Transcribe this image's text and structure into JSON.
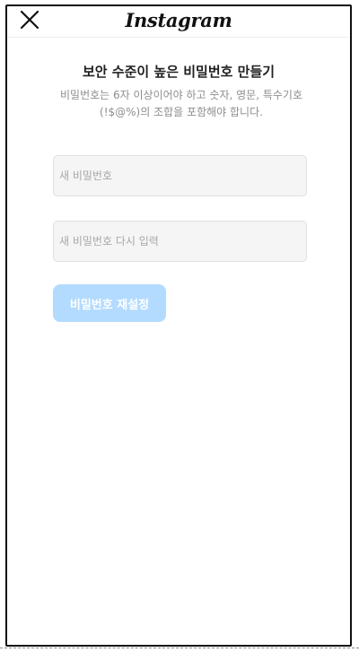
{
  "header": {
    "logo_text": "Instagram",
    "close_icon": "close-icon"
  },
  "main": {
    "title": "보안 수준이 높은 비밀번호 만들기",
    "description": "비밀번호는 6자 이상이어야 하고 숫자, 영문, 특수기호(!$@%)의 조합을 포함해야 합니다.",
    "new_password": {
      "value": "",
      "placeholder": "새 비밀번호"
    },
    "confirm_password": {
      "value": "",
      "placeholder": "새 비밀번호 다시 입력"
    },
    "reset_button_label": "비밀번호 재설정",
    "reset_button_color": "#b3dbff"
  }
}
